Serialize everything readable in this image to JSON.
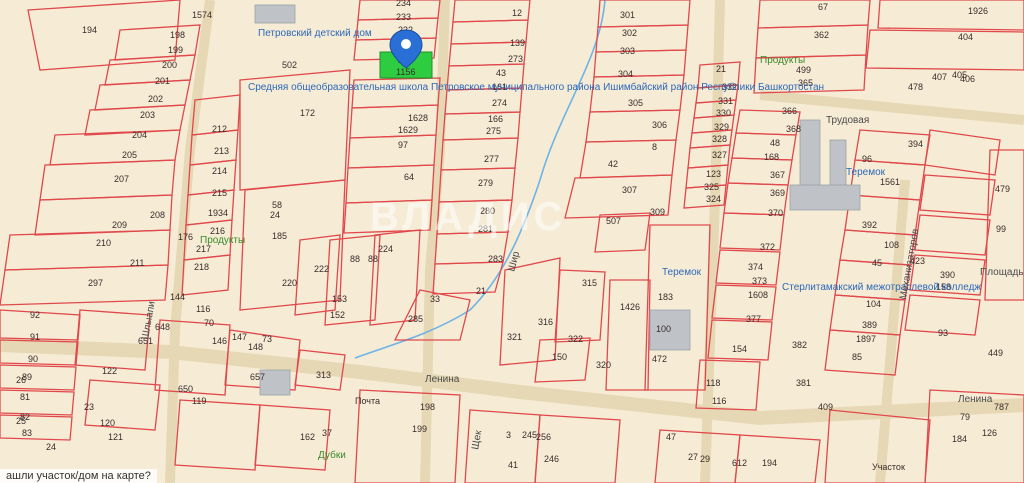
{
  "map": {
    "parcel_numbers": [
      "194",
      "1574",
      "198",
      "199",
      "200",
      "201",
      "202",
      "203",
      "204",
      "205",
      "207",
      "208",
      "209",
      "210",
      "211",
      "297",
      "212",
      "213",
      "214",
      "215",
      "1934",
      "216",
      "217",
      "218",
      "234",
      "233",
      "232",
      "231",
      "230",
      "12",
      "139",
      "273",
      "43",
      "161",
      "274",
      "166",
      "275",
      "97",
      "1629",
      "1628",
      "64",
      "277",
      "279",
      "280",
      "281",
      "283",
      "21",
      "33",
      "285",
      "224",
      "88",
      "88",
      "153",
      "152",
      "220",
      "222",
      "24",
      "58",
      "185",
      "301",
      "302",
      "303",
      "304",
      "305",
      "306",
      "8",
      "42",
      "307",
      "309",
      "507",
      "315",
      "316",
      "321",
      "322",
      "150",
      "320",
      "1426",
      "183",
      "472",
      "100",
      "21",
      "332",
      "331",
      "330",
      "329",
      "328",
      "327",
      "123",
      "325",
      "324",
      "67",
      "362",
      "499",
      "365",
      "366",
      "368",
      "48",
      "168",
      "367",
      "369",
      "370",
      "372",
      "374",
      "373",
      "1608",
      "377",
      "154",
      "118",
      "116",
      "96",
      "394",
      "1561",
      "392",
      "108",
      "45",
      "423",
      "158",
      "390",
      "104",
      "389",
      "1897",
      "85",
      "382",
      "381",
      "409",
      "1926",
      "404",
      "405",
      "406",
      "407",
      "478",
      "479",
      "99",
      "93",
      "92",
      "91",
      "90",
      "89",
      "81",
      "82",
      "83",
      "26",
      "25",
      "24",
      "23",
      "120",
      "121",
      "122",
      "119",
      "650",
      "651",
      "648",
      "146",
      "147",
      "148",
      "73",
      "657",
      "313",
      "198",
      "199",
      "162",
      "37",
      "3",
      "41",
      "245",
      "256",
      "246",
      "47",
      "27",
      "29",
      "612",
      "194",
      "449",
      "79",
      "787",
      "126",
      "184",
      "502",
      "172",
      "176",
      "144",
      "116",
      "70"
    ],
    "pois": {
      "kindergarten": "Петровский детский дом",
      "school": "Средняя общеобразовательная школа Петровское муниципального района Ишимбайский район Республики Башкортостан",
      "shop1": "Продукты",
      "shop2": "Продукты",
      "teremok1": "Теремок",
      "teremok2": "Теремок",
      "college": "Стерлитамакский межотраслевой колледж",
      "shop3": "Дубки",
      "sell": "Участок",
      "post": "Почта"
    },
    "streets": {
      "lenina1": "Ленина",
      "lenina2": "Ленина",
      "trudovaya": "Трудовая",
      "mekhanizatorov": "Механизаторов",
      "shlyapnikova": "Шлыапи",
      "shirokaya": "Шир",
      "shchek": "Щек",
      "ploshad": "Площадь"
    },
    "watermark": "ВЛАДИС",
    "marker": "1156"
  },
  "bottom_text": "ашли участок/дом на карте?",
  "colors": {
    "background": "#f6ecd6",
    "parcel_stroke": "#e0484c",
    "river": "#6fb3e6",
    "selected_parcel": "#2ecc40",
    "marker": "#2a6fd6"
  }
}
